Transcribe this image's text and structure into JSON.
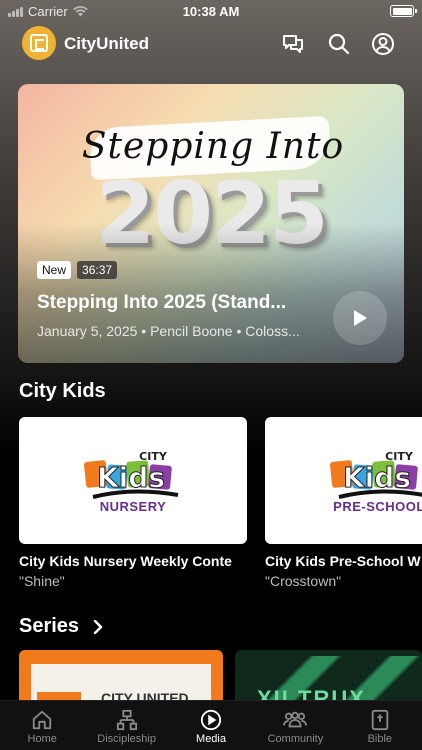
{
  "status": {
    "carrier": "Carrier",
    "time": "10:38 AM"
  },
  "header": {
    "app_name": "CityUnited",
    "icons": [
      "chat-icon",
      "search-icon",
      "account-icon"
    ]
  },
  "hero": {
    "script_text": "Stepping Into",
    "year_text": "2025",
    "badge_new": "New",
    "duration": "36:37",
    "title": "Stepping Into 2025 (Stand...",
    "meta": "January 5, 2025 • Pencil Boone • Coloss..."
  },
  "city_kids": {
    "title": "City Kids",
    "items": [
      {
        "logo_word": "Kids",
        "logo_top": "CITY",
        "logo_sub": "NURSERY",
        "caption": "City Kids Nursery Weekly Conte",
        "subtitle": "\"Shine\""
      },
      {
        "logo_word": "Kids",
        "logo_top": "CITY",
        "logo_sub": "PRE-SCHOOL",
        "caption": "City Kids Pre-School W",
        "subtitle": "\"Crosstown\""
      }
    ]
  },
  "series": {
    "title": "Series",
    "items": [
      {
        "label": "CITY UNITED"
      },
      {
        "label": "XII TRUX"
      }
    ]
  },
  "tabs": [
    {
      "label": "Home",
      "icon": "home-icon",
      "active": false
    },
    {
      "label": "Discipleship",
      "icon": "discipleship-icon",
      "active": false
    },
    {
      "label": "Media",
      "icon": "media-play-icon",
      "active": true
    },
    {
      "label": "Community",
      "icon": "community-icon",
      "active": false
    },
    {
      "label": "Bible",
      "icon": "bible-icon",
      "active": false
    }
  ],
  "colors": {
    "accent": "#f0b233",
    "kids_purple": "#6a2c8c",
    "series_orange": "#f07a1c",
    "series_green": "#1f6b43"
  }
}
